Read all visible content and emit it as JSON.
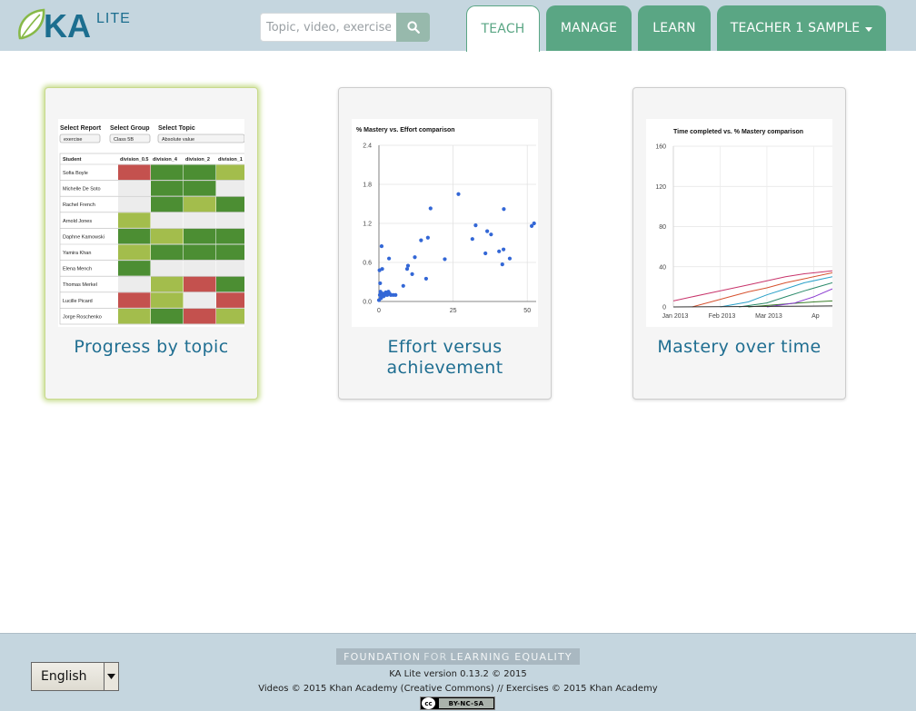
{
  "header": {
    "logo_ka": "KA",
    "logo_lite": "LITE",
    "search": {
      "placeholder": "Topic, video, exercise..."
    },
    "nav": [
      {
        "label": "TEACH",
        "active": true
      },
      {
        "label": "MANAGE",
        "active": false
      },
      {
        "label": "LEARN",
        "active": false
      },
      {
        "label": "TEACHER 1 SAMPLE",
        "active": false,
        "dropdown": true
      }
    ],
    "colors": {
      "bar": "#c5d6df",
      "tab": "#5aa684",
      "search_button": "#97b9ac"
    }
  },
  "cards": [
    {
      "title": "Progress by topic",
      "highlighted": true,
      "thumb": {
        "selects": [
          {
            "label": "Select Report",
            "value": "exercise"
          },
          {
            "label": "Select Group",
            "value": "Class 5B"
          },
          {
            "label": "Select Topic",
            "value": "Absolute value"
          }
        ],
        "columns": [
          "Student",
          "division_0.5",
          "division_4",
          "division_2",
          "division_1"
        ],
        "rows": [
          {
            "name": "Sofia Boyle",
            "cells": [
              "r",
              "g",
              "g",
              "l"
            ]
          },
          {
            "name": "Michelle De Soto",
            "cells": [
              "w",
              "g",
              "g",
              "w"
            ]
          },
          {
            "name": "Rachel French",
            "cells": [
              "w",
              "g",
              "l",
              "g"
            ]
          },
          {
            "name": "Arnold Jones",
            "cells": [
              "l",
              "w",
              "w",
              "w"
            ]
          },
          {
            "name": "Daphne Kamowski",
            "cells": [
              "g",
              "l",
              "g",
              "g"
            ]
          },
          {
            "name": "Yamira Khan",
            "cells": [
              "l",
              "g",
              "g",
              "g"
            ]
          },
          {
            "name": "Elena Mench",
            "cells": [
              "g",
              "w",
              "w",
              "w"
            ]
          },
          {
            "name": "Thomas Merkel",
            "cells": [
              "w",
              "l",
              "r",
              "g"
            ]
          },
          {
            "name": "Lucille Picard",
            "cells": [
              "r",
              "l",
              "w",
              "r"
            ]
          },
          {
            "name": "Jorge Roschenko",
            "cells": [
              "l",
              "g",
              "r",
              "l"
            ]
          }
        ],
        "cell_colors": {
          "r": "#c4514e",
          "g": "#4c8e33",
          "l": "#a3bd4c",
          "w": "#ececec"
        }
      }
    },
    {
      "title": "Effort versus achievement",
      "highlighted": false,
      "chart_data": {
        "type": "scatter",
        "title": "% Mastery vs. Effort comparison",
        "xlim": [
          0,
          53
        ],
        "ylim": [
          0,
          2.4
        ],
        "x_ticks": [
          0,
          25,
          50
        ],
        "y_ticks": [
          "0.0",
          "0.6",
          "1.2",
          "1.8",
          "2.4"
        ],
        "point_color": "#3367d6",
        "points": [
          [
            0,
            0.02
          ],
          [
            0.3,
            0.1
          ],
          [
            0.5,
            0.15
          ],
          [
            0.7,
            0.05
          ],
          [
            1,
            0.1
          ],
          [
            1.3,
            0.12
          ],
          [
            1.6,
            0.08
          ],
          [
            2,
            0.1
          ],
          [
            2.3,
            0.14
          ],
          [
            2.8,
            0.1
          ],
          [
            3.2,
            0.15
          ],
          [
            3.6,
            0.12
          ],
          [
            4,
            0.1
          ],
          [
            0.4,
            0.28
          ],
          [
            0.2,
            0.48
          ],
          [
            1.1,
            0.5
          ],
          [
            0.9,
            0.85
          ],
          [
            3.4,
            0.66
          ],
          [
            4.8,
            0.1
          ],
          [
            5.6,
            0.1
          ],
          [
            8.2,
            0.24
          ],
          [
            9.5,
            0.5
          ],
          [
            9.8,
            0.55
          ],
          [
            11.2,
            0.42
          ],
          [
            12.1,
            0.68
          ],
          [
            14.2,
            0.94
          ],
          [
            15.9,
            0.35
          ],
          [
            16.5,
            0.98
          ],
          [
            17.4,
            1.43
          ],
          [
            22.2,
            0.65
          ],
          [
            26.8,
            1.65
          ],
          [
            31.5,
            0.96
          ],
          [
            32.6,
            1.17
          ],
          [
            35.9,
            0.74
          ],
          [
            36.5,
            1.08
          ],
          [
            37.8,
            1.03
          ],
          [
            40.5,
            0.77
          ],
          [
            41.6,
            0.57
          ],
          [
            42,
            0.8
          ],
          [
            42.1,
            1.42
          ],
          [
            44.1,
            0.66
          ],
          [
            51.5,
            1.16
          ],
          [
            52.3,
            1.2
          ]
        ]
      }
    },
    {
      "title": "Mastery over time",
      "highlighted": false,
      "chart_data": {
        "type": "line",
        "title": "Time completed vs. % Mastery comparison",
        "x_ticks": [
          "Jan 2013",
          "Feb 2013",
          "Mar 2013",
          "Ap"
        ],
        "ylim": [
          0,
          160
        ],
        "y_ticks": [
          0,
          40,
          80,
          120,
          160
        ],
        "series": [
          {
            "color": "#c8346b",
            "values": [
              [
                0,
                6
              ],
              [
                0.4,
                10
              ],
              [
                0.8,
                14
              ],
              [
                1.2,
                18
              ],
              [
                1.6,
                22
              ],
              [
                2.0,
                26
              ],
              [
                2.4,
                30
              ],
              [
                2.8,
                33
              ],
              [
                3.4,
                36
              ]
            ]
          },
          {
            "color": "#d6512e",
            "values": [
              [
                0.4,
                0
              ],
              [
                0.8,
                5
              ],
              [
                1.2,
                10
              ],
              [
                1.6,
                15
              ],
              [
                2.0,
                19
              ],
              [
                2.4,
                24
              ],
              [
                2.8,
                28
              ],
              [
                3.4,
                34
              ]
            ]
          },
          {
            "color": "#2aa0c8",
            "values": [
              [
                1.0,
                0
              ],
              [
                1.6,
                5
              ],
              [
                2.0,
                12
              ],
              [
                2.4,
                18
              ],
              [
                2.8,
                24
              ],
              [
                3.4,
                30
              ]
            ]
          },
          {
            "color": "#2a8a6a",
            "values": [
              [
                1.4,
                0
              ],
              [
                2.0,
                4
              ],
              [
                2.4,
                10
              ],
              [
                2.8,
                16
              ],
              [
                3.4,
                24
              ]
            ]
          },
          {
            "color": "#3a7f2a",
            "values": [
              [
                1.6,
                0
              ],
              [
                2.4,
                3
              ],
              [
                3.0,
                5
              ],
              [
                3.4,
                6
              ]
            ]
          },
          {
            "color": "#8a3ad0",
            "values": [
              [
                2.0,
                0
              ],
              [
                2.6,
                4
              ],
              [
                3.0,
                10
              ],
              [
                3.4,
                18
              ]
            ]
          },
          {
            "color": "#333333",
            "values": [
              [
                0,
                0
              ],
              [
                3.4,
                1
              ]
            ]
          }
        ]
      }
    }
  ],
  "footer": {
    "language": "English",
    "fle_left": "FOUNDATION",
    "fle_mid": "FOR",
    "fle_right": "LEARNING EQUALITY",
    "version": "KA Lite version 0.13.2 © 2015",
    "credits": "Videos © 2015 Khan Academy (Creative Commons) // Exercises © 2015 Khan Academy",
    "cc_symbol": "cc",
    "license": "BY-NC-SA"
  }
}
